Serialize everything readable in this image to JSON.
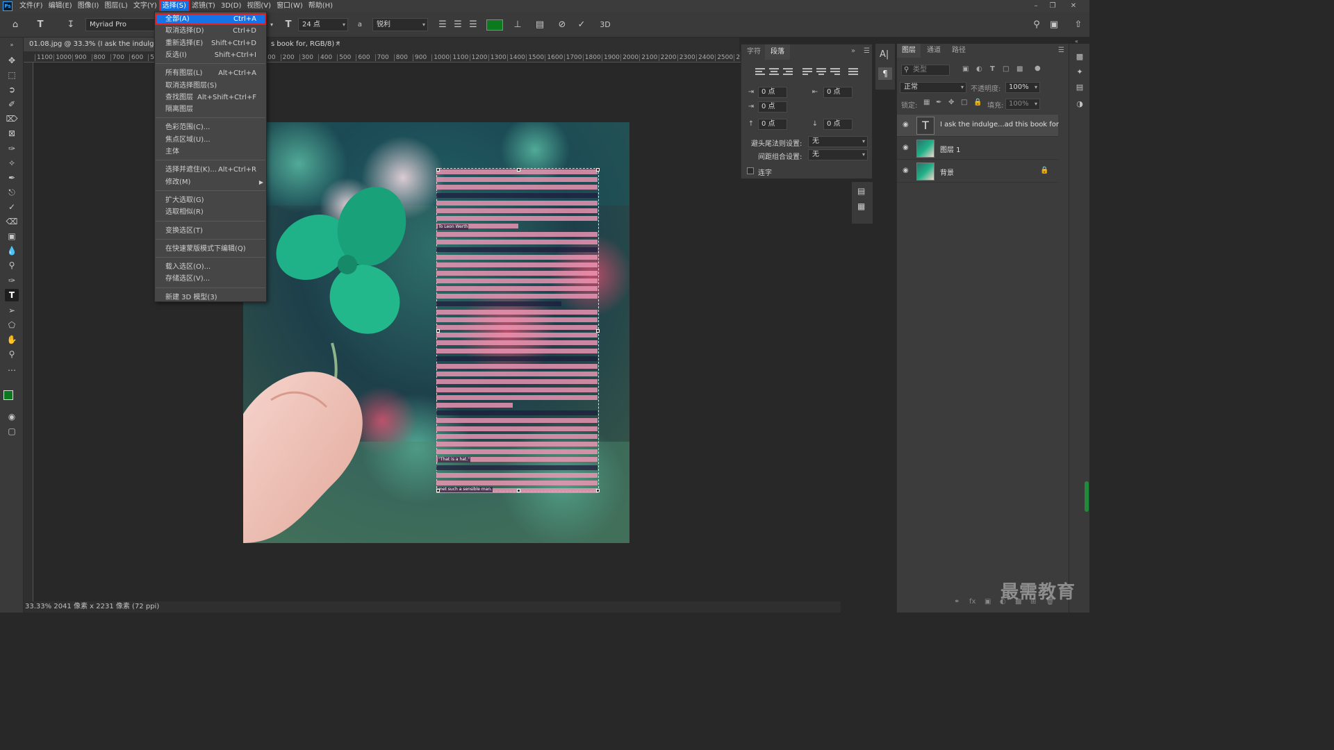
{
  "app": {
    "logo": "Ps"
  },
  "menubar": {
    "items": [
      "文件(F)",
      "编辑(E)",
      "图像(I)",
      "图层(L)",
      "文字(Y)",
      "选择(S)",
      "滤镜(T)",
      "3D(D)",
      "视图(V)",
      "窗口(W)",
      "帮助(H)"
    ],
    "active": "选择(S)"
  },
  "options_bar": {
    "font_family": "Myriad Pro",
    "font_size": "24 点",
    "antialias": "锐利",
    "text_color": "#0b7a1f",
    "three_d": "3D"
  },
  "document": {
    "tab_title_left": "01.08.jpg @ 33.3% (I ask the indulgenc",
    "tab_title_right": "s book for, RGB/8) *",
    "zoom_status": "33.33%",
    "size_status": "2041 像素 x 2231 像素 (72 ppi)"
  },
  "ruler_ticks": [
    "1100",
    "1000",
    "900",
    "800",
    "700",
    "600",
    "500",
    "400",
    "300",
    "200",
    "100",
    "0",
    "100",
    "200",
    "300",
    "400",
    "500",
    "600",
    "700",
    "800",
    "900",
    "1000",
    "1100",
    "1200",
    "1300",
    "1400",
    "1500",
    "1600",
    "1700",
    "1800",
    "1900",
    "2000",
    "2100",
    "2200",
    "2300",
    "2400",
    "2500",
    "2"
  ],
  "select_menu": {
    "groups": [
      [
        {
          "label": "全部(A)",
          "shortcut": "Ctrl+A",
          "highlighted": true
        },
        {
          "label": "取消选择(D)",
          "shortcut": "Ctrl+D"
        },
        {
          "label": "重新选择(E)",
          "shortcut": "Shift+Ctrl+D"
        },
        {
          "label": "反选(I)",
          "shortcut": "Shift+Ctrl+I"
        }
      ],
      [
        {
          "label": "所有图层(L)",
          "shortcut": "Alt+Ctrl+A"
        },
        {
          "label": "取消选择图层(S)",
          "shortcut": ""
        },
        {
          "label": "查找图层",
          "shortcut": "Alt+Shift+Ctrl+F"
        },
        {
          "label": "隔离图层",
          "shortcut": ""
        }
      ],
      [
        {
          "label": "色彩范围(C)...",
          "shortcut": ""
        },
        {
          "label": "焦点区域(U)...",
          "shortcut": ""
        },
        {
          "label": "主体",
          "shortcut": ""
        }
      ],
      [
        {
          "label": "选择并遮住(K)...",
          "shortcut": "Alt+Ctrl+R"
        },
        {
          "label": "修改(M)",
          "shortcut": "",
          "submenu": true
        }
      ],
      [
        {
          "label": "扩大选取(G)",
          "shortcut": ""
        },
        {
          "label": "选取相似(R)",
          "shortcut": ""
        }
      ],
      [
        {
          "label": "变换选区(T)",
          "shortcut": ""
        }
      ],
      [
        {
          "label": "在快速蒙版模式下编辑(Q)",
          "shortcut": ""
        }
      ],
      [
        {
          "label": "载入选区(O)...",
          "shortcut": ""
        },
        {
          "label": "存储选区(V)...",
          "shortcut": ""
        }
      ],
      [
        {
          "label": "新建 3D 模型(3)",
          "shortcut": ""
        }
      ]
    ]
  },
  "paragraph_panel": {
    "tabs": [
      "字符",
      "段落"
    ],
    "active_tab": "段落",
    "indent_left": "0 点",
    "indent_right": "0 点",
    "indent_first": "0 点",
    "space_before": "0 点",
    "space_after": "0 点",
    "kinsoku_label": "避头尾法则设置:",
    "kinsoku_value": "无",
    "mojikumi_label": "间距组合设置:",
    "mojikumi_value": "无",
    "hyphenate_label": "连字"
  },
  "layers_panel": {
    "tabs": [
      "图层",
      "通道",
      "路径"
    ],
    "active_tab": "图层",
    "filter_placeholder": "类型",
    "blend_mode": "正常",
    "opacity_label": "不透明度:",
    "opacity_value": "100%",
    "lock_label": "锁定:",
    "fill_label": "填充:",
    "fill_value": "100%",
    "layers": [
      {
        "name": "I ask the indulge...ad this book for",
        "kind": "text",
        "selected": true
      },
      {
        "name": "图层 1",
        "kind": "image",
        "selected": false
      },
      {
        "name": "背景",
        "kind": "image",
        "selected": false,
        "locked": true
      }
    ]
  },
  "doc_text_lines": [
    "To Leon Werth",
    "\"That is a hat.\"",
    "met such a sensible man."
  ],
  "watermark": "最需教育"
}
